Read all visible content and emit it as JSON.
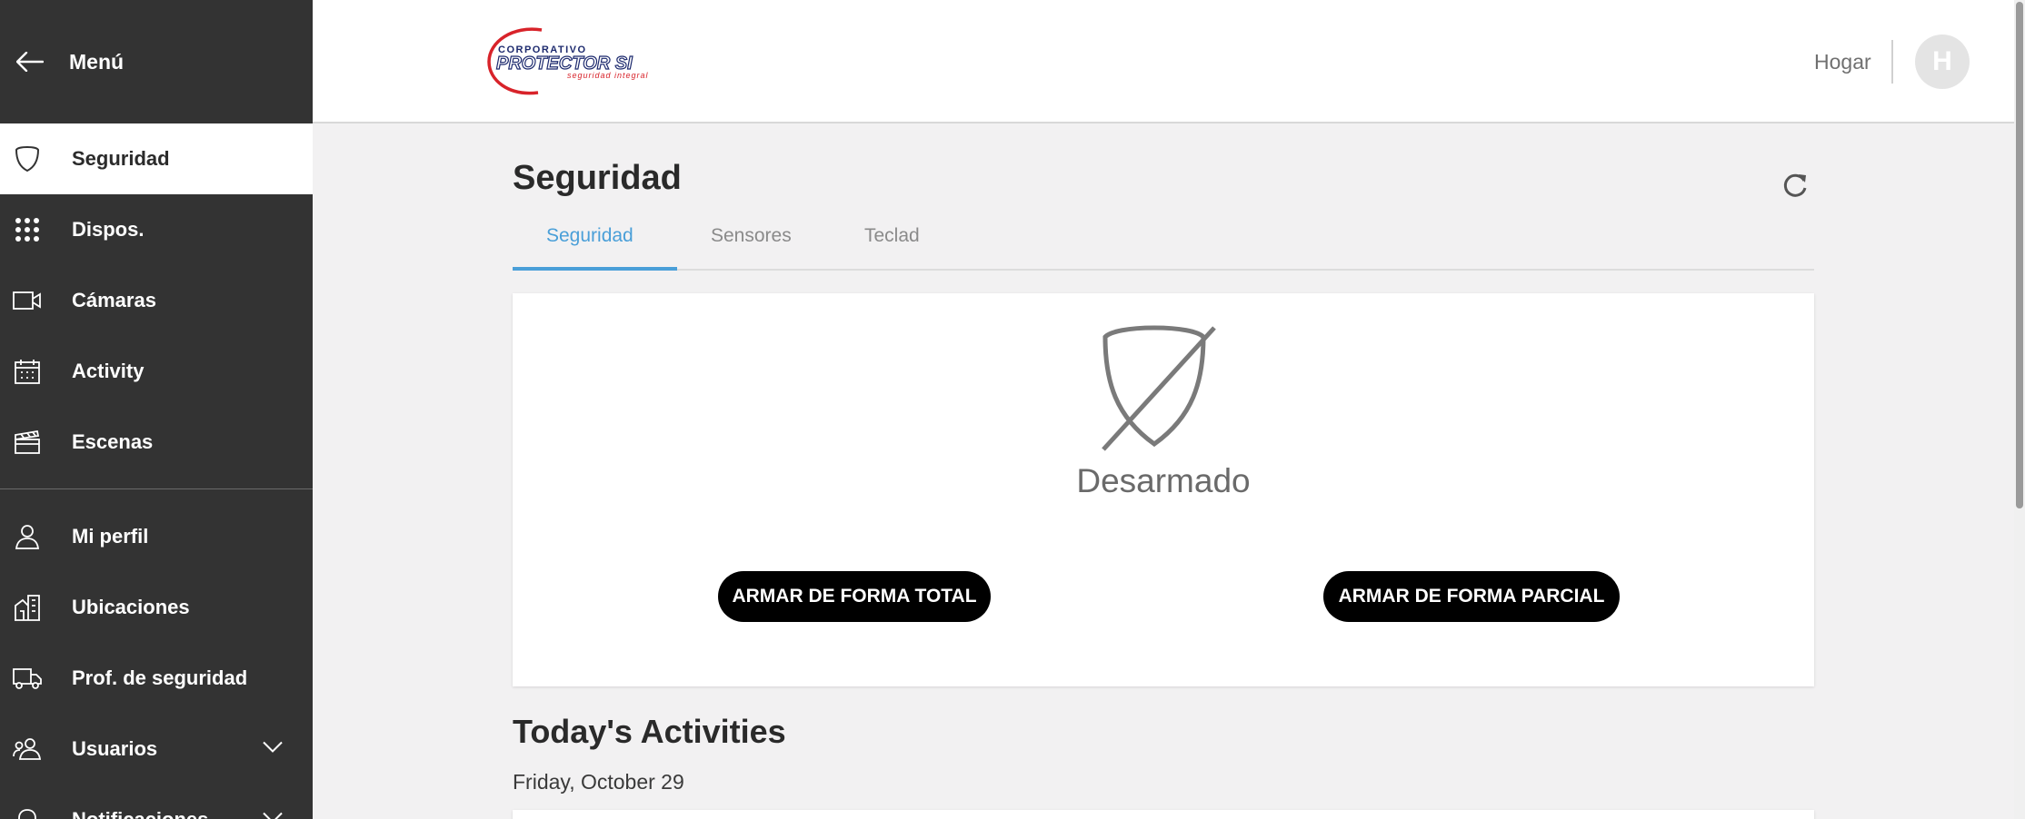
{
  "sidebar": {
    "title": "Menú",
    "items": [
      {
        "label": "Seguridad"
      },
      {
        "label": "Dispos."
      },
      {
        "label": "Cámaras"
      },
      {
        "label": "Activity"
      },
      {
        "label": "Escenas"
      },
      {
        "label": "Mi perfil"
      },
      {
        "label": "Ubicaciones"
      },
      {
        "label": "Prof. de seguridad"
      },
      {
        "label": "Usuarios"
      },
      {
        "label": "Notificaciones"
      }
    ]
  },
  "header": {
    "logo": {
      "top": "CORPORATIVO",
      "main": "PROTECTOR SI",
      "tagline": "seguridad integral"
    },
    "location": "Hogar",
    "avatar_initial": "H"
  },
  "main": {
    "title": "Seguridad",
    "tabs": [
      {
        "label": "Seguridad"
      },
      {
        "label": "Sensores"
      },
      {
        "label": "Teclad"
      }
    ],
    "status": "Desarmado",
    "arm_total_label": "ARMAR DE FORMA TOTAL",
    "arm_partial_label": "ARMAR DE FORMA PARCIAL",
    "activities_title": "Today's Activities",
    "activities_date": "Friday, October 29"
  },
  "colors": {
    "sidebar_bg": "#333333",
    "accent": "#4a9fd8",
    "button_bg": "#000000",
    "page_bg": "#f2f1f2"
  }
}
